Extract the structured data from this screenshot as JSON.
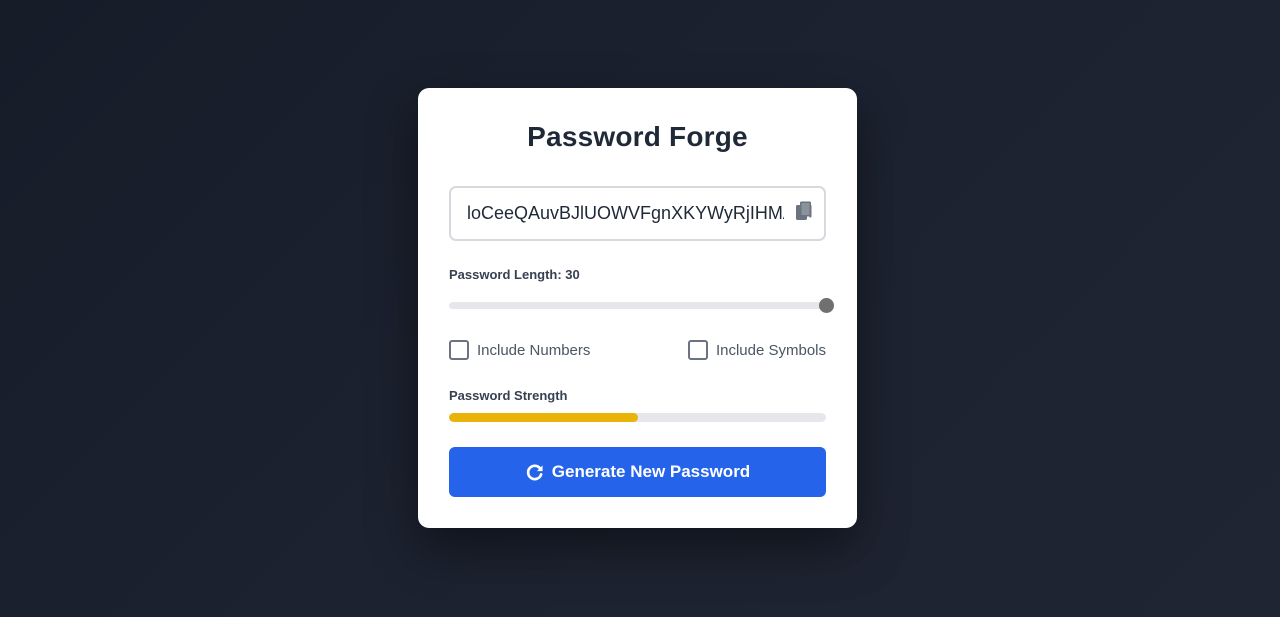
{
  "app": {
    "title": "Password Forge"
  },
  "password": {
    "value": "loCeeQAuvBJlUOWVFgnXKYWyRjIHMA",
    "copy_icon": "copy-icon"
  },
  "length": {
    "label": "Password Length: 30",
    "value": 30,
    "min": 8,
    "max": 30
  },
  "options": {
    "numbers": {
      "label": "Include Numbers",
      "checked": false
    },
    "symbols": {
      "label": "Include Symbols",
      "checked": false
    }
  },
  "strength": {
    "label": "Password Strength",
    "fraction": 0.5,
    "color": "#eab308"
  },
  "generate_button": {
    "label": "Generate New Password",
    "icon": "refresh-icon"
  },
  "colors": {
    "accent": "#2563eb",
    "slider_thumb": "#707070",
    "track": "#e5e7eb"
  }
}
